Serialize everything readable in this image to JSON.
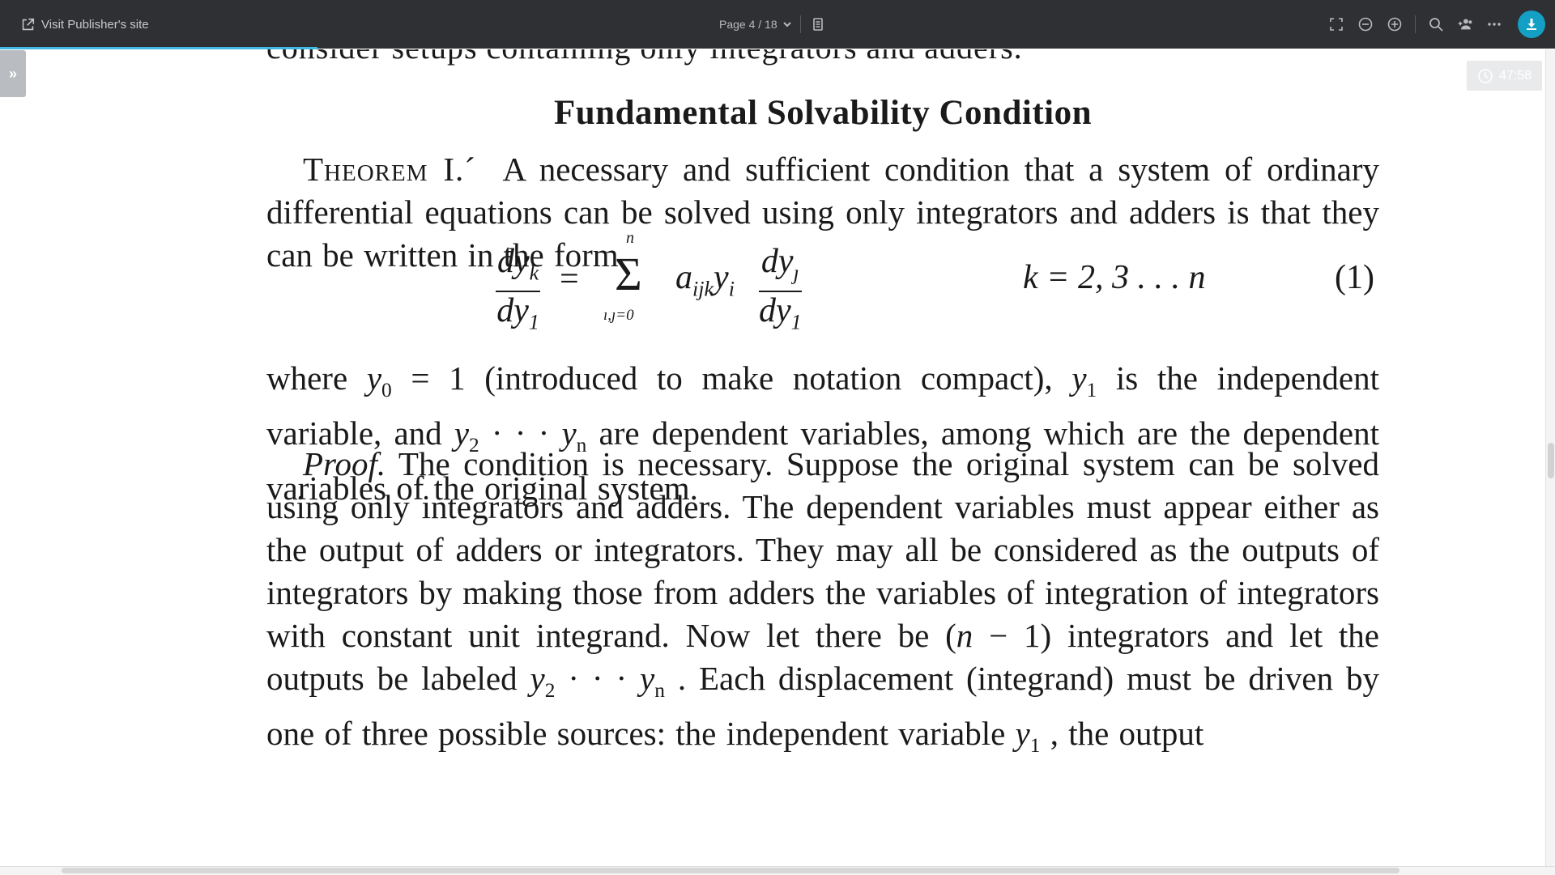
{
  "toolbar": {
    "publisher_link": "Visit Publisher's site",
    "page_indicator": "Page 4 / 18"
  },
  "timer": "47:58",
  "side_tab": "»",
  "icons": [
    "external-link-icon",
    "chevron-down-icon",
    "page-view-icon",
    "fullscreen-icon",
    "zoom-out-icon",
    "zoom-in-icon",
    "search-icon",
    "share-users-icon",
    "more-icon",
    "download-icon",
    "clock-icon"
  ],
  "colors": {
    "toolbar_bg": "#2e3033",
    "accent": "#14a0c4",
    "progress": "#3fb8e4"
  },
  "document": {
    "cut_line": "consider setups containing only integrators and adders.",
    "heading": "Fundamental Solvability Condition",
    "theorem_label": "Theorem I.",
    "theorem_tick": "´",
    "theorem_text": "A necessary and sufficient condition that a system of ordinary differential equations can be solved using only integrators and adders is that they can be written in the form",
    "equation": {
      "lhs_num": "dy",
      "lhs_num_sub": "k",
      "lhs_den": "dy",
      "lhs_den_sub": "1",
      "equals": "=",
      "sum_upper": "n",
      "sum_symbol": "Σ",
      "sum_lower": "ı,ȷ=0",
      "term": "a",
      "term_sub": "ijk",
      "term_y": "y",
      "term_y_sub": "i",
      "rhs_num": "dy",
      "rhs_num_sub": "ȷ",
      "rhs_den": "dy",
      "rhs_den_sub": "1",
      "condition": "k = 2, 3 . . . n",
      "number": "(1)"
    },
    "where_para": {
      "p1": "where ",
      "y0": "y",
      "y0_sub": "0",
      "p2": " = 1 (introduced to make notation compact), ",
      "y1": "y",
      "y1_sub": "1",
      "p3": " is the independent variable, and ",
      "y2": "y",
      "y2_sub": "2",
      "dots": " · · · ",
      "yn": "y",
      "yn_sub": "n",
      "p4": " are dependent variables, among which are the dependent variables of the original system."
    },
    "proof_para": {
      "label": "Proof.",
      "p1": " The condition is necessary. Suppose the original system can be solved using only integrators and adders. The dependent variables must appear either as the output of adders or integrators. They may all be considered as the outputs of integrators by making those from adders the variables of integration of integrators with constant unit integrand. Now let there be (",
      "n": "n",
      "p2": " − 1) integrators and let the outputs be labeled ",
      "y2": "y",
      "y2_sub": "2",
      "dots": " · · · ",
      "yn": "y",
      "yn_sub": "n",
      "p3": " . Each displacement (integrand) must be driven by one of three possible sources: the independent variable ",
      "y1": "y",
      "y1_sub": "1",
      "p4": " , the output"
    }
  }
}
